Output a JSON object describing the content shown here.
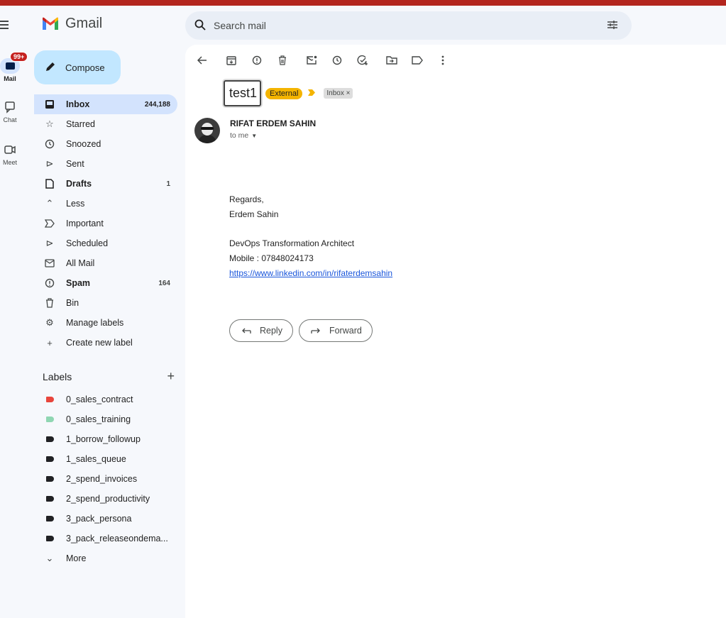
{
  "app": {
    "name": "Gmail"
  },
  "rail": {
    "mail_label": "Mail",
    "mail_badge": "99+",
    "chat_label": "Chat",
    "meet_label": "Meet"
  },
  "search": {
    "placeholder": "Search mail"
  },
  "compose": {
    "label": "Compose"
  },
  "nav": [
    {
      "label": "Inbox",
      "count": "244,188",
      "icon": "inbox-icon"
    },
    {
      "label": "Starred",
      "count": "",
      "icon": "star-icon"
    },
    {
      "label": "Snoozed",
      "count": "",
      "icon": "clock-icon"
    },
    {
      "label": "Sent",
      "count": "",
      "icon": "send-icon"
    },
    {
      "label": "Drafts",
      "count": "1",
      "icon": "draft-icon"
    },
    {
      "label": "Less",
      "count": "",
      "icon": "chevron-up-icon"
    },
    {
      "label": "Important",
      "count": "",
      "icon": "important-icon"
    },
    {
      "label": "Scheduled",
      "count": "",
      "icon": "scheduled-icon"
    },
    {
      "label": "All Mail",
      "count": "",
      "icon": "all-mail-icon"
    },
    {
      "label": "Spam",
      "count": "164",
      "icon": "spam-icon"
    },
    {
      "label": "Bin",
      "count": "",
      "icon": "trash-icon"
    },
    {
      "label": "Manage labels",
      "count": "",
      "icon": "gear-icon"
    },
    {
      "label": "Create new label",
      "count": "",
      "icon": "plus-icon"
    }
  ],
  "labels_section": {
    "title": "Labels",
    "items": [
      {
        "label": "0_sales_contract",
        "color": "#e8453c"
      },
      {
        "label": "0_sales_training",
        "color": "#8fd6b2"
      },
      {
        "label": "1_borrow_followup",
        "color": "#202124"
      },
      {
        "label": "1_sales_queue",
        "color": "#202124"
      },
      {
        "label": "2_spend_invoices",
        "color": "#202124"
      },
      {
        "label": "2_spend_productivity",
        "color": "#202124"
      },
      {
        "label": "3_pack_persona",
        "color": "#202124"
      },
      {
        "label": "3_pack_releaseondema...",
        "color": "#202124"
      }
    ],
    "more_label": "More"
  },
  "email": {
    "subject": "test1",
    "tag_external": "External",
    "tag_inbox": "Inbox",
    "tag_inbox_close": "×",
    "sender_name": "RIFAT ERDEM SAHIN",
    "recipient": "to me",
    "body": {
      "regards": "Regards,",
      "name": "Erdem Sahin",
      "title": "DevOps Transformation Architect",
      "mobile": "Mobile : 07848024173",
      "link": "https://www.linkedin.com/in/rifaterdemsahin"
    },
    "reply_label": "Reply",
    "forward_label": "Forward"
  },
  "colors": {
    "compose_bg": "#c2e7ff",
    "active_nav_bg": "#d3e3fd",
    "external_tag": "#f4b400",
    "badge_red": "#c5221f",
    "top_bar": "#b3261e"
  }
}
